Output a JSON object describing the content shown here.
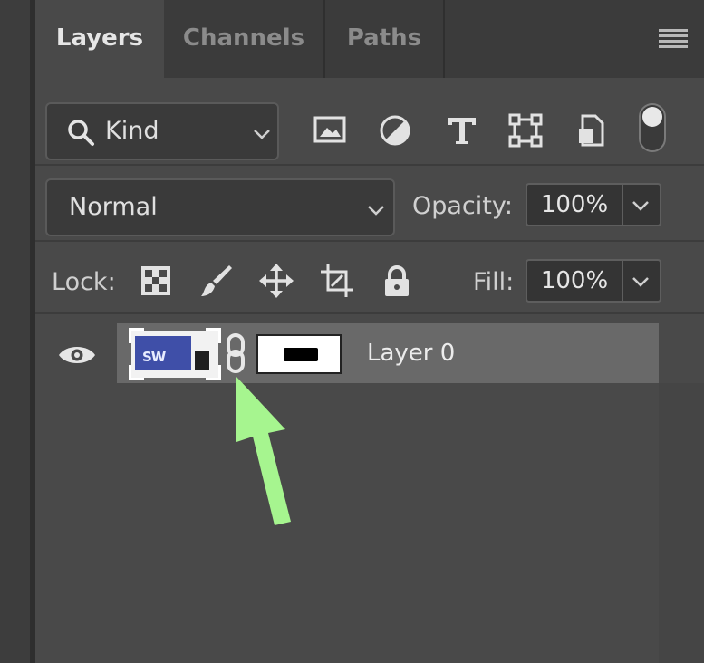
{
  "tabs": [
    {
      "label": "Layers",
      "active": true
    },
    {
      "label": "Channels",
      "active": false
    },
    {
      "label": "Paths",
      "active": false
    }
  ],
  "filter": {
    "kind_label": "Kind",
    "icons": [
      "image-filter-icon",
      "adjustment-filter-icon",
      "type-filter-icon",
      "shape-filter-icon",
      "smart-object-filter-icon"
    ]
  },
  "blend": {
    "mode": "Normal",
    "opacity_label": "Opacity:",
    "opacity_value": "100%"
  },
  "lock": {
    "label": "Lock:",
    "icons": [
      "lock-transparent-pixels-icon",
      "lock-image-pixels-icon",
      "lock-position-icon",
      "lock-artboard-icon",
      "lock-all-icon"
    ],
    "fill_label": "Fill:",
    "fill_value": "100%"
  },
  "layer": {
    "name": "Layer 0",
    "thumbnail_text": "SW"
  },
  "colors": {
    "panel_bg": "#494949",
    "selected_row": "#696969",
    "annotation_arrow": "#a6f58f"
  }
}
